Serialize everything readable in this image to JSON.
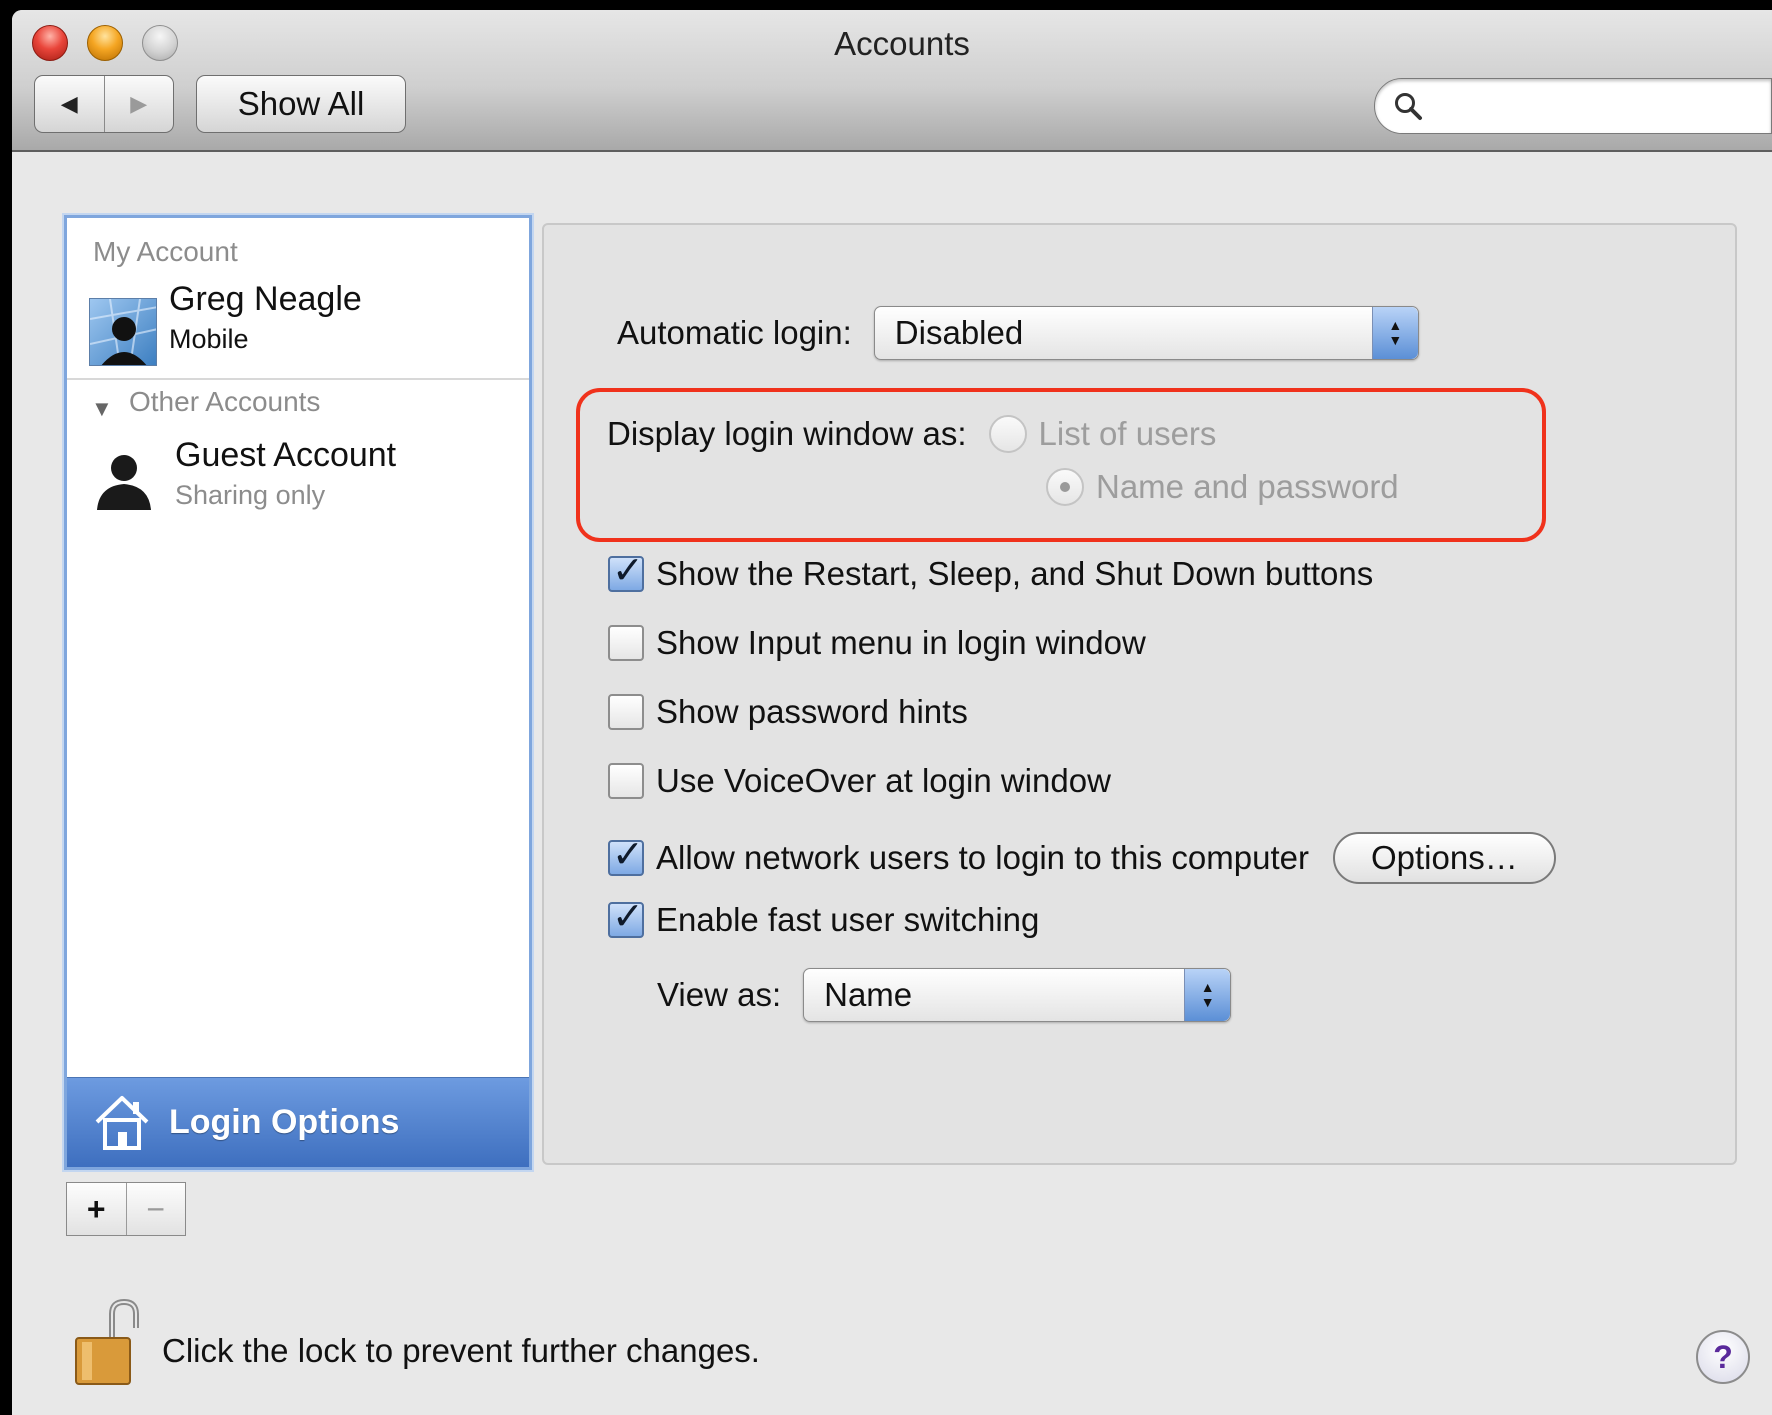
{
  "window": {
    "title": "Accounts"
  },
  "toolbar": {
    "back_icon": "back-arrow-icon",
    "forward_icon": "forward-arrow-icon",
    "show_all_label": "Show All",
    "search_placeholder": "",
    "search_value": ""
  },
  "sidebar": {
    "my_account_header": "My Account",
    "my_account": {
      "name": "Greg Neagle",
      "sub": "Mobile"
    },
    "other_accounts_header": "Other Accounts",
    "other_accounts": [
      {
        "name": "Guest Account",
        "sub": "Sharing only"
      }
    ],
    "login_options_label": "Login Options",
    "add_label": "+",
    "remove_label": "−"
  },
  "login": {
    "auto_login_label": "Automatic login:",
    "auto_login_value": "Disabled",
    "display_as_label": "Display login window as:",
    "display_options": [
      "List of users",
      "Name and password"
    ],
    "display_selected": "Name and password",
    "checkboxes": [
      {
        "label": "Show the Restart, Sleep, and Shut Down buttons",
        "checked": true
      },
      {
        "label": "Show Input menu in login window",
        "checked": false
      },
      {
        "label": "Show password hints",
        "checked": false
      },
      {
        "label": "Use VoiceOver at login window",
        "checked": false
      },
      {
        "label": "Allow network users to login to this computer",
        "checked": true
      },
      {
        "label": "Enable fast user switching",
        "checked": true
      }
    ],
    "options_button": "Options…",
    "view_as_label": "View as:",
    "view_as_value": "Name",
    "highlight_color": "#f0321c"
  },
  "footer": {
    "lock_text": "Click the lock to prevent further changes.",
    "help_label": "?"
  }
}
